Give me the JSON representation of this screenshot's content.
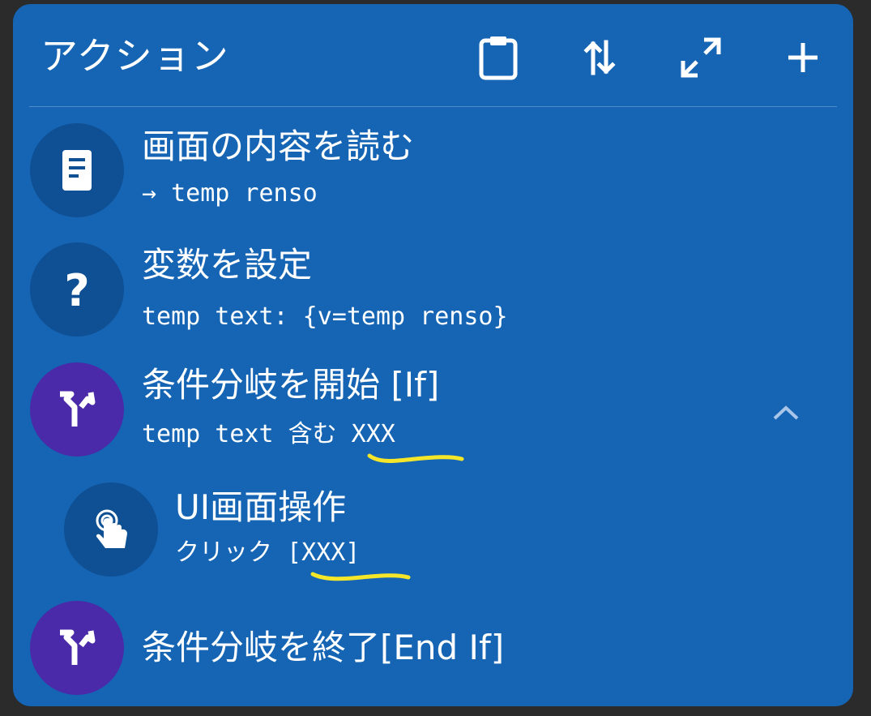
{
  "header": {
    "title": "アクション"
  },
  "actions": [
    {
      "title": "画面の内容を読む",
      "subtitle": "→ temp renso"
    },
    {
      "title": "変数を設定",
      "subtitle": "temp text: {v=temp renso}"
    },
    {
      "title": "条件分岐を開始 [If]",
      "subtitle": "temp text 含む XXX"
    },
    {
      "title": "UI画面操作",
      "subtitle": "クリック [XXX]"
    },
    {
      "title": "条件分岐を終了[End If]",
      "subtitle": ""
    }
  ],
  "icons": {
    "screen_read": "document-icon",
    "set_variable": "question-icon",
    "if_start": "branch-icon",
    "ui_action": "touch-icon",
    "if_end": "branch-icon",
    "clipboard": "clipboard-icon",
    "sort": "sort-icon",
    "expand": "expand-icon",
    "add": "plus-icon",
    "collapse": "chevron-up-icon"
  },
  "colors": {
    "card_background": "#1565b4",
    "icon_blue": "#0f4f93",
    "icon_purple": "#4a2aa8",
    "highlight_marker": "#f5e62a"
  }
}
